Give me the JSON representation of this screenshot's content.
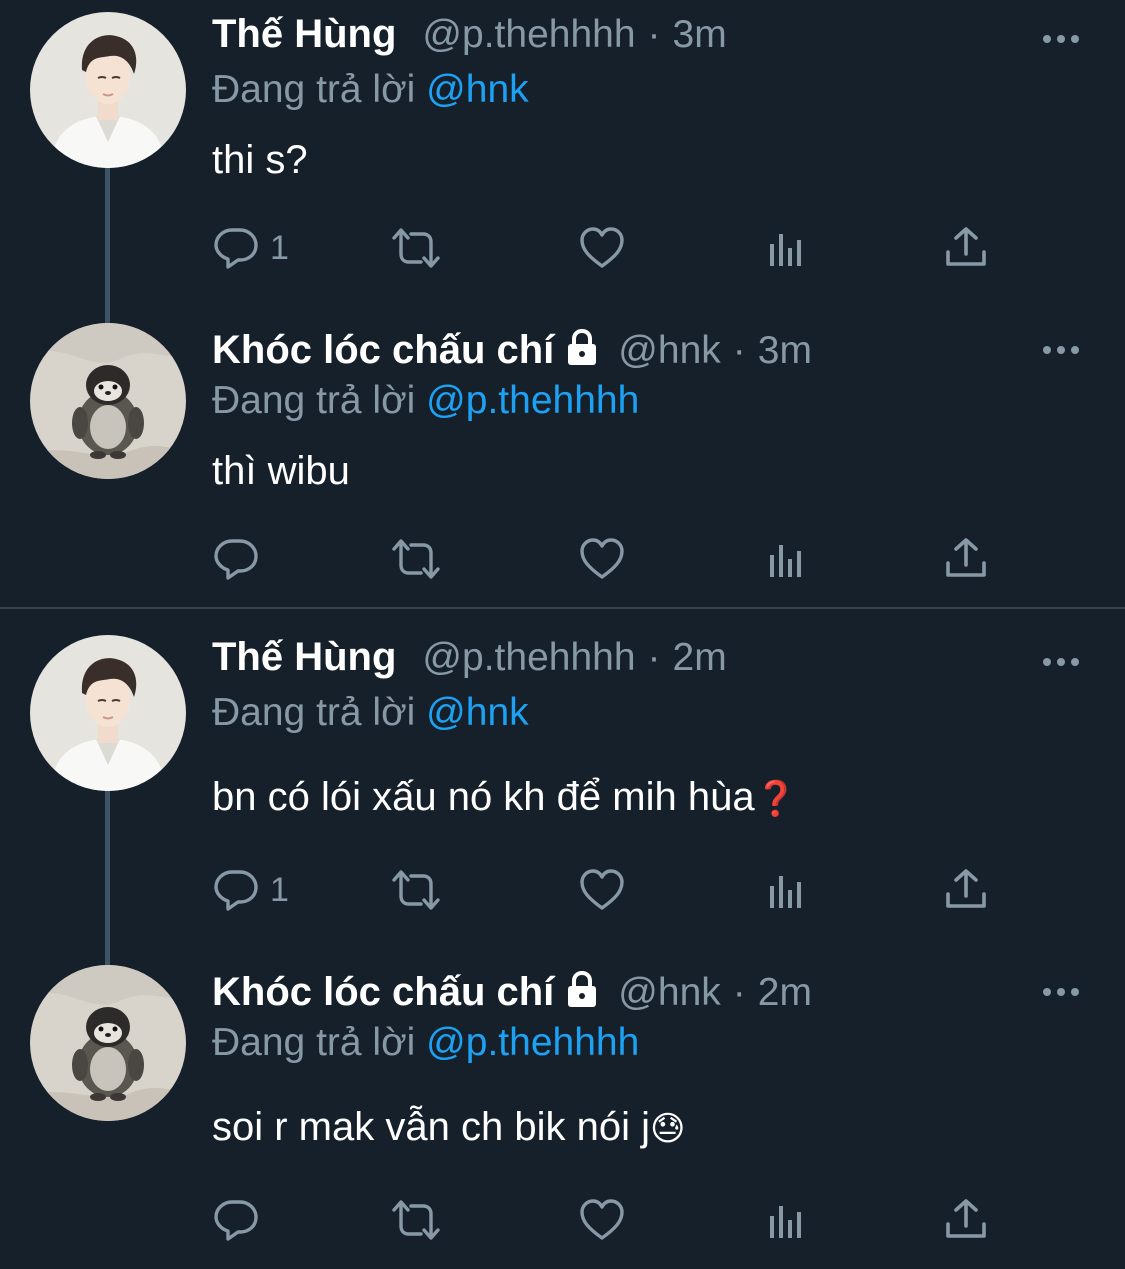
{
  "tweets": [
    {
      "name": "Thế Hùng",
      "handle": "@p.thehhhh",
      "separator": "·",
      "time": "3m",
      "replying_prefix": "Đang trả lời",
      "replying_to": "@hnk",
      "text": "thi s?",
      "reply_count": "1",
      "locked": false,
      "avatar": "man-in-white-shirt"
    },
    {
      "name": "Khóc lóc chấu chí",
      "handle": "@hnk",
      "separator": "·",
      "time": "3m",
      "replying_prefix": "Đang trả lời",
      "replying_to": "@p.thehhhh",
      "text": "thì wibu",
      "reply_count": "",
      "locked": true,
      "avatar": "penguin-plush"
    },
    {
      "name": "Thế Hùng",
      "handle": "@p.thehhhh",
      "separator": "·",
      "time": "2m",
      "replying_prefix": "Đang trả lời",
      "replying_to": "@hnk",
      "text": "bn có lói xấu nó kh để mih hùa",
      "text_emoji": "❓",
      "reply_count": "1",
      "locked": false,
      "avatar": "man-in-white-shirt"
    },
    {
      "name": "Khóc lóc chấu chí",
      "handle": "@hnk",
      "separator": "·",
      "time": "2m",
      "replying_prefix": "Đang trả lời",
      "replying_to": "@p.thehhhh",
      "text": "soi r mak vẫn ch bik nói j",
      "text_emoji": "😓",
      "reply_count": "",
      "locked": true,
      "avatar": "penguin-plush"
    }
  ],
  "colors": {
    "background": "#15202b",
    "secondary_text": "#8899a6",
    "mention": "#1da1f2",
    "thread_line": "#3d5466",
    "divider": "#38444d"
  }
}
